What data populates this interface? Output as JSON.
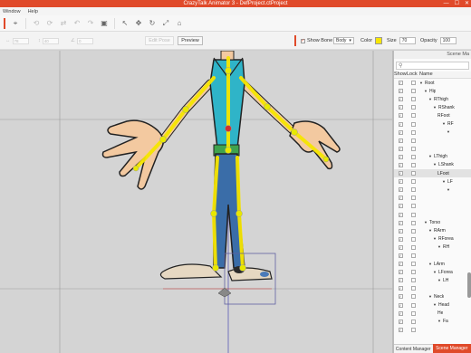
{
  "title": "CrazyTalk Animator 3  -  DefProject.ctProject",
  "window_buttons": [
    "—",
    "☐",
    "✕"
  ],
  "menu": [
    "Window",
    "Help"
  ],
  "toolbar": {
    "icons": [
      "select-tool-icon",
      "rotate-left-icon",
      "rotate-right-icon",
      "flip-icon",
      "undo-icon",
      "redo-icon",
      "camera-icon",
      "arrow-tool-icon",
      "move-tool-icon",
      "rotate-tool-icon",
      "scale-tool-icon",
      "pin-tool-icon"
    ],
    "glyphs": [
      "⌖",
      "⟲",
      "⟳",
      "⇄",
      "↶",
      "↷",
      "▣",
      "↖",
      "✥",
      "↻",
      "⤢",
      "⌂"
    ]
  },
  "propbar": {
    "field1": "78",
    "field2": "40",
    "field3": "0",
    "edit_pose": "Edit Pose",
    "preview": "Preview",
    "show_bone": "Show Bone",
    "show_bone_checked": true,
    "bone_mode": "Body",
    "color_label": "Color",
    "bone_color": "#f7e600",
    "size_label": "Size",
    "size_value": "70",
    "opacity_label": "Opacity",
    "opacity_value": "100"
  },
  "scene_panel": {
    "title": "Scene Ma",
    "search_icon": "search-icon",
    "columns": [
      "Show",
      "Lock",
      "Name"
    ],
    "rows": [
      {
        "name": "Root",
        "indent": 0,
        "expand": true,
        "selected": false
      },
      {
        "name": "Hip",
        "indent": 1,
        "expand": true,
        "selected": false
      },
      {
        "name": "RThigh",
        "indent": 2,
        "expand": true,
        "selected": false
      },
      {
        "name": "RShank",
        "indent": 3,
        "expand": true,
        "selected": false
      },
      {
        "name": "RFoot",
        "indent": 4,
        "expand": false,
        "selected": false
      },
      {
        "name": "RF",
        "indent": 5,
        "expand": true,
        "selected": false
      },
      {
        "name": "",
        "indent": 6,
        "expand": true,
        "selected": false
      },
      {
        "name": "",
        "indent": 6,
        "expand": false,
        "selected": false
      },
      {
        "name": "",
        "indent": 6,
        "expand": false,
        "selected": false
      },
      {
        "name": "LThigh",
        "indent": 2,
        "expand": true,
        "selected": false
      },
      {
        "name": "LShank",
        "indent": 3,
        "expand": true,
        "selected": false
      },
      {
        "name": "LFoot",
        "indent": 4,
        "expand": false,
        "selected": true
      },
      {
        "name": "LF",
        "indent": 5,
        "expand": true,
        "selected": false
      },
      {
        "name": "",
        "indent": 6,
        "expand": true,
        "selected": false
      },
      {
        "name": "",
        "indent": 6,
        "expand": false,
        "selected": false
      },
      {
        "name": "",
        "indent": 6,
        "expand": false,
        "selected": false
      },
      {
        "name": "",
        "indent": 6,
        "expand": false,
        "selected": false
      },
      {
        "name": "Torso",
        "indent": 1,
        "expand": true,
        "selected": false
      },
      {
        "name": "RArm",
        "indent": 2,
        "expand": true,
        "selected": false
      },
      {
        "name": "RForea",
        "indent": 3,
        "expand": true,
        "selected": false
      },
      {
        "name": "RH",
        "indent": 4,
        "expand": true,
        "selected": false
      },
      {
        "name": "",
        "indent": 5,
        "expand": false,
        "selected": false
      },
      {
        "name": "LArm",
        "indent": 2,
        "expand": true,
        "selected": false
      },
      {
        "name": "LForea",
        "indent": 3,
        "expand": true,
        "selected": false
      },
      {
        "name": "LH",
        "indent": 4,
        "expand": true,
        "selected": false
      },
      {
        "name": "",
        "indent": 5,
        "expand": false,
        "selected": false
      },
      {
        "name": "Neck",
        "indent": 2,
        "expand": true,
        "selected": false
      },
      {
        "name": "Head",
        "indent": 3,
        "expand": true,
        "selected": false
      },
      {
        "name": "He",
        "indent": 4,
        "expand": false,
        "selected": false
      },
      {
        "name": "Fa",
        "indent": 4,
        "expand": true,
        "selected": false
      },
      {
        "name": "",
        "indent": 5,
        "expand": false,
        "selected": false
      }
    ],
    "tabs": {
      "content": "Content Manager",
      "scene": "Scene Manager"
    }
  },
  "colors": {
    "accent": "#e04a2a",
    "bone": "#f7e600",
    "bone_joint": "#e8e800"
  }
}
